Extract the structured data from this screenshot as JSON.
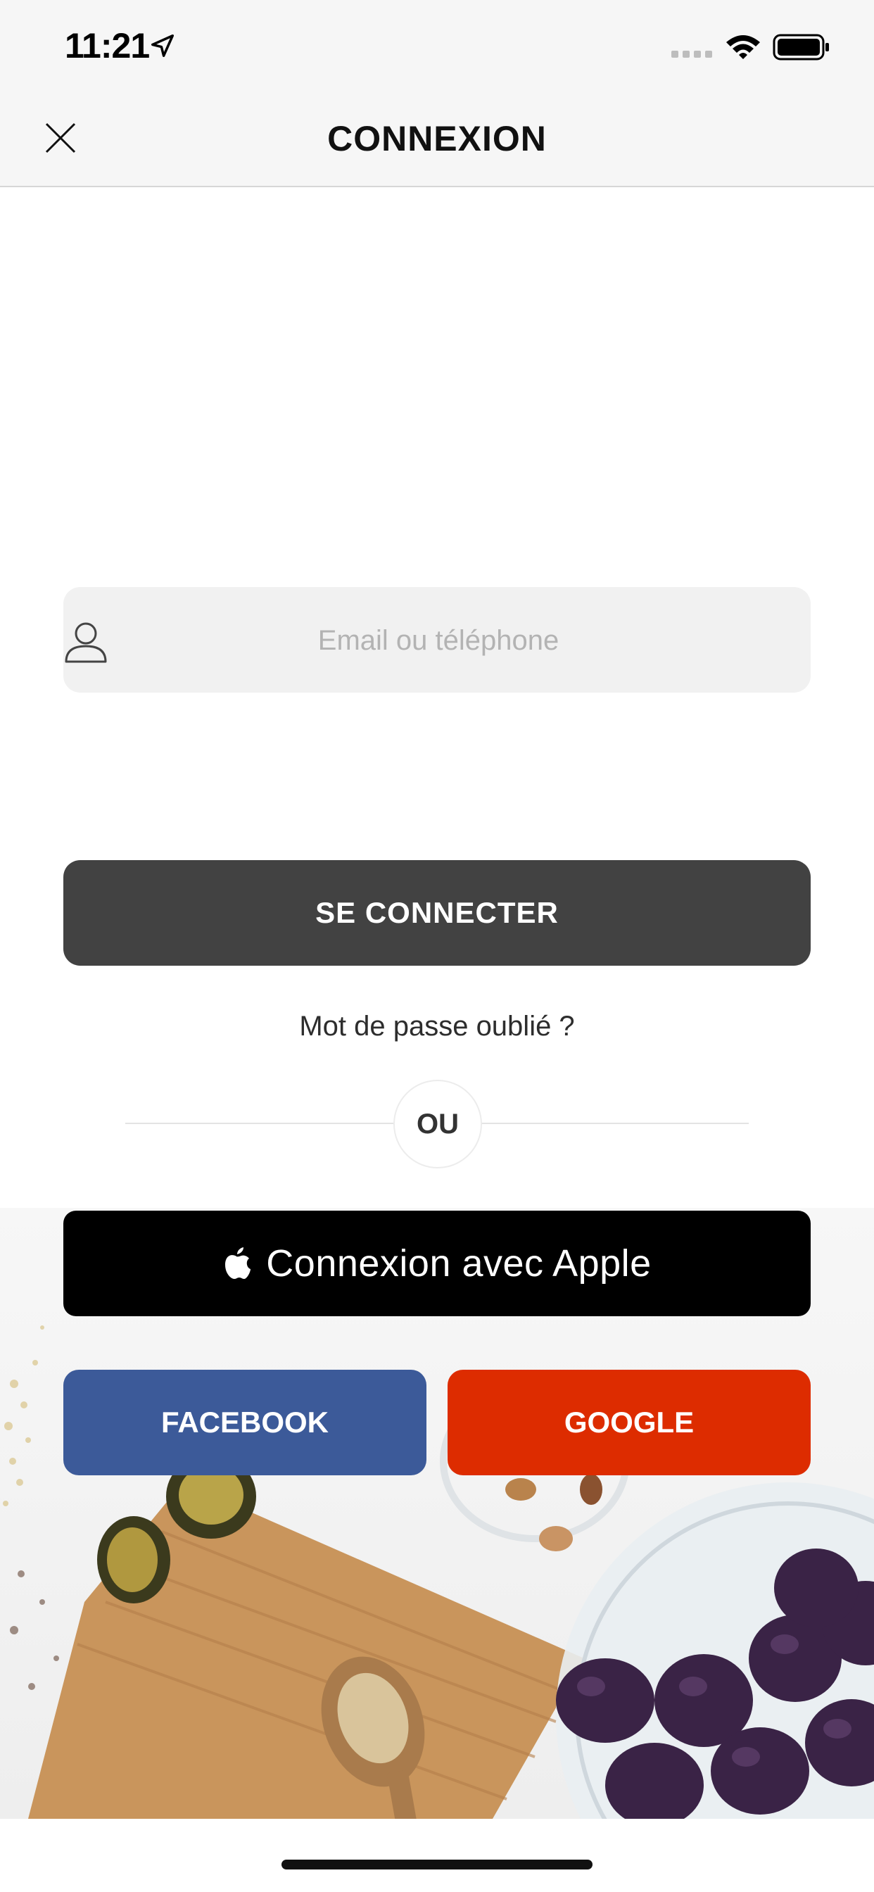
{
  "status_bar": {
    "time": "11:21",
    "icons": [
      "location-arrow-icon",
      "signal-icon",
      "wifi-icon",
      "battery-icon"
    ]
  },
  "nav": {
    "title": "CONNEXION",
    "close_icon": "close-icon"
  },
  "login": {
    "email_placeholder": "Email ou téléphone",
    "email_value": "",
    "user_icon": "user-icon",
    "submit_label": "SE CONNECTER",
    "forgot_password": "Mot de passe oublié ?",
    "separator_text": "OU"
  },
  "social": {
    "apple_label": "Connexion avec Apple",
    "facebook_label": "FACEBOOK",
    "google_label": "GOOGLE"
  },
  "colors": {
    "primary_button": "#424242",
    "apple": "#000000",
    "facebook": "#3c5a99",
    "google": "#dd2c00"
  }
}
